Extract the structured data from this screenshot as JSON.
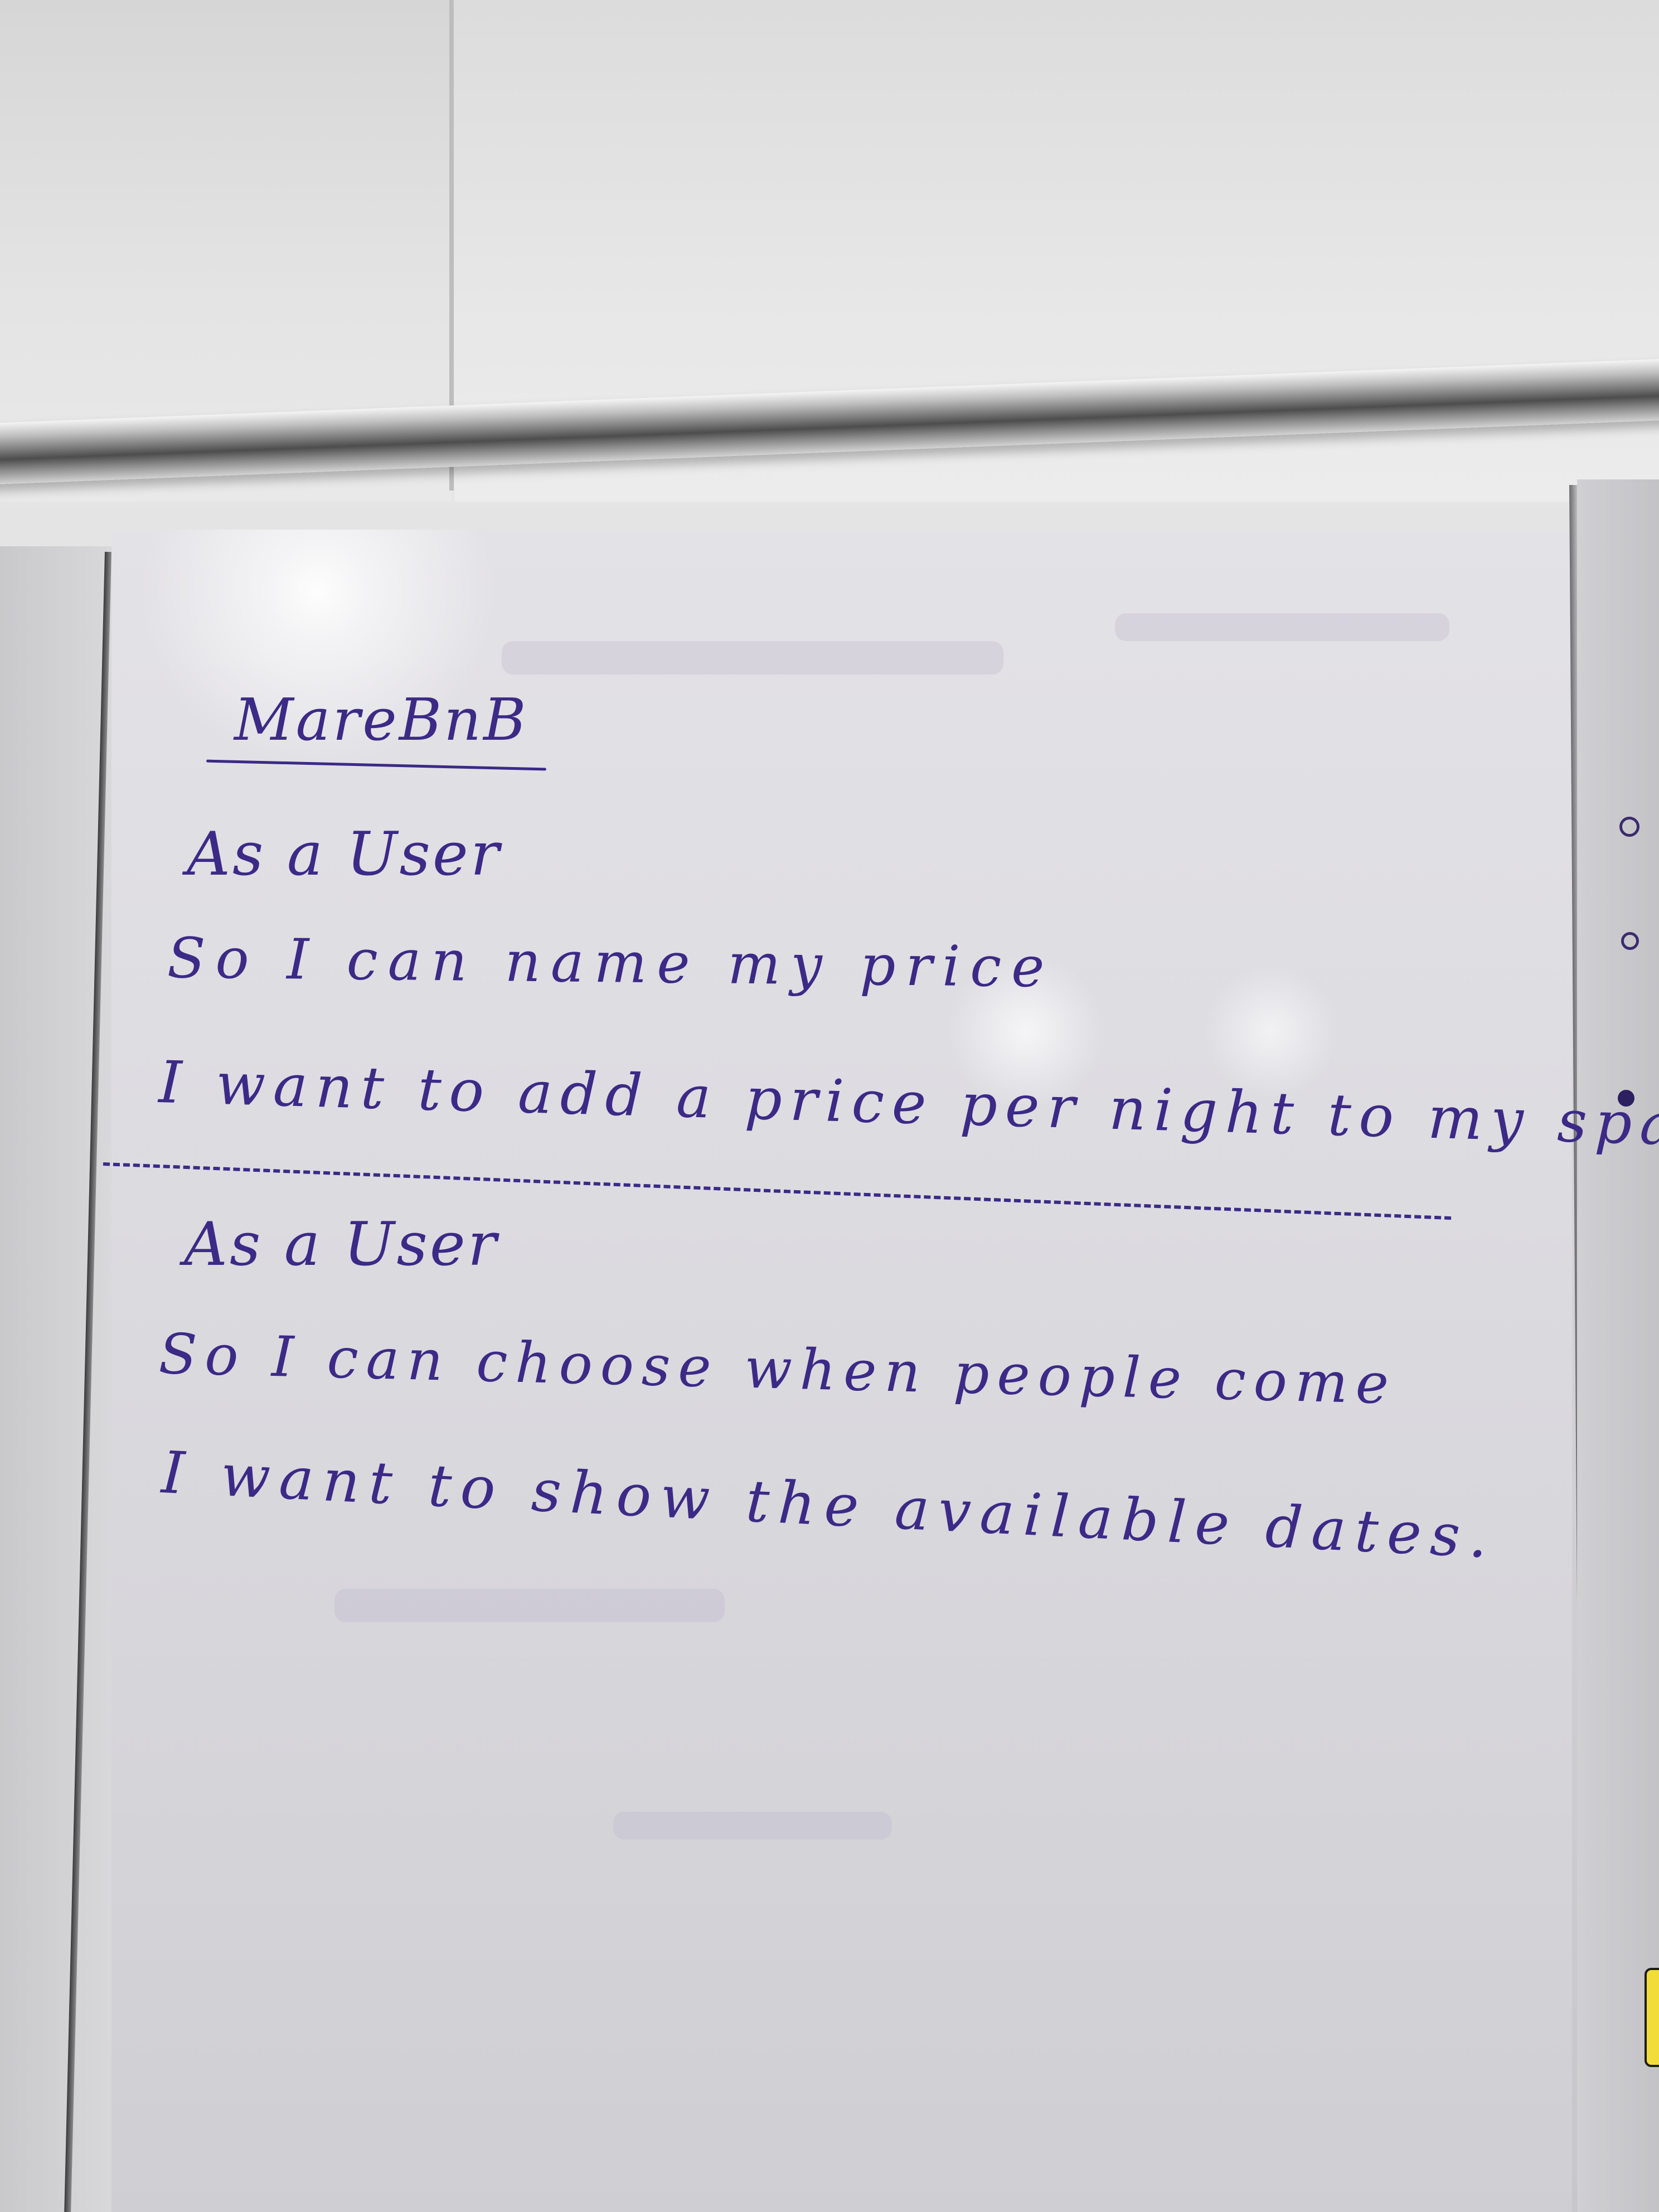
{
  "whiteboard": {
    "title": "MareBnB",
    "story_1": {
      "role": "As a User",
      "goal": "So I can name my price",
      "want": "I want to add a price per night to my space."
    },
    "story_2": {
      "role": "As a User",
      "goal": "So I can choose when people come",
      "want": "I want to show the available dates."
    },
    "ink_color": "#3b2a86",
    "divider_style": "dashed line"
  }
}
